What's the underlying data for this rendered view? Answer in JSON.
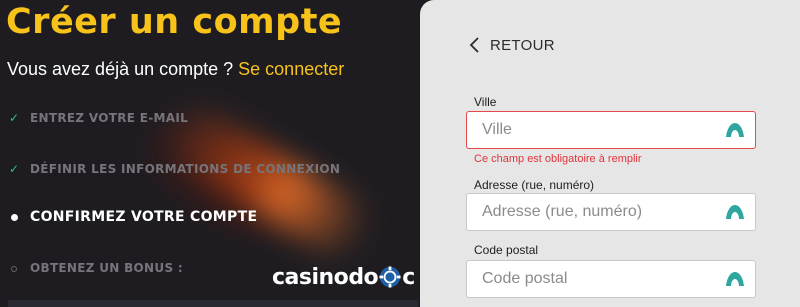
{
  "left": {
    "title": "Créer un compte",
    "subtitle_text": "Vous avez déjà un compte ? ",
    "subtitle_link": "Se connecter",
    "steps": [
      {
        "label": "ENTREZ VOTRE E-MAIL",
        "state": "done"
      },
      {
        "label": "DÉFINIR LES INFORMATIONS DE CONNEXION",
        "state": "done"
      },
      {
        "label": "CONFIRMEZ VOTRE COMPTE",
        "state": "active"
      },
      {
        "label": "OBTENEZ UN BONUS :",
        "state": "pending"
      }
    ],
    "logo_text_before": "casino",
    "logo_text_after": "c",
    "logo_chip_text": "do"
  },
  "right": {
    "back_label": "RETOUR",
    "fields": [
      {
        "label": "Ville",
        "placeholder": "Ville",
        "value": "",
        "error": "Ce champ est obligatoire à remplir"
      },
      {
        "label": "Adresse (rue, numéro)",
        "placeholder": "Adresse (rue, numéro)",
        "value": ""
      },
      {
        "label": "Code postal",
        "placeholder": "Code postal",
        "value": ""
      }
    ]
  },
  "colors": {
    "accent_yellow": "#f7c21a",
    "check_green": "#2fbf8a",
    "error_red": "#e0343b",
    "icon_teal": "#2fa7a0",
    "panel_dark": "#1e1c21",
    "panel_light": "#e6e6e6"
  },
  "icons": {
    "done": "check-icon",
    "active": "dot-icon",
    "pending": "ring-icon",
    "back": "chevron-left-icon",
    "field": "autofill-key-icon"
  }
}
